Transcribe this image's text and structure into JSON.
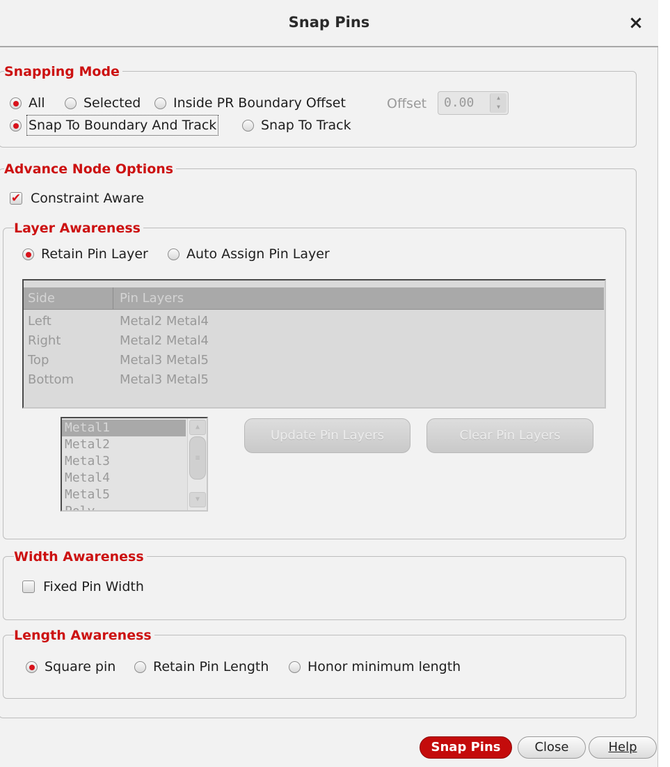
{
  "dialog": {
    "title": "Snap Pins",
    "close_glyph": "×"
  },
  "snapping_mode": {
    "legend": "Snapping Mode",
    "scope": [
      {
        "label": "All",
        "selected": true
      },
      {
        "label": "Selected",
        "selected": false
      },
      {
        "label": "Inside PR Boundary Offset",
        "selected": false
      }
    ],
    "offset_label": "Offset",
    "offset_value": "0.00",
    "target": [
      {
        "label": "Snap To Boundary And Track",
        "selected": true
      },
      {
        "label": "Snap To Track",
        "selected": false
      }
    ]
  },
  "advance_node": {
    "legend": "Advance Node Options",
    "constraint_aware": {
      "label": "Constraint Aware",
      "checked": true
    },
    "layer_awareness": {
      "legend": "Layer Awareness",
      "options": [
        {
          "label": "Retain Pin Layer",
          "selected": true
        },
        {
          "label": "Auto Assign Pin Layer",
          "selected": false
        }
      ],
      "table": {
        "headers": [
          "Side",
          "Pin Layers"
        ],
        "rows": [
          [
            "Left",
            "Metal2 Metal4"
          ],
          [
            "Right",
            "Metal2 Metal4"
          ],
          [
            "Top",
            "Metal3 Metal5"
          ],
          [
            "Bottom",
            "Metal3 Metal5"
          ]
        ]
      },
      "layer_list": [
        "Metal1",
        "Metal2",
        "Metal3",
        "Metal4",
        "Metal5",
        "Poly"
      ],
      "selected_layer": "Metal1",
      "update_button": "Update Pin Layers",
      "clear_button": "Clear Pin Layers"
    },
    "width_awareness": {
      "legend": "Width Awareness",
      "fixed_pin_width": {
        "label": "Fixed Pin Width",
        "checked": false
      }
    },
    "length_awareness": {
      "legend": "Length Awareness",
      "options": [
        {
          "label": "Square pin",
          "selected": true
        },
        {
          "label": "Retain Pin Length",
          "selected": false
        },
        {
          "label": "Honor minimum length",
          "selected": false
        }
      ]
    }
  },
  "footer": {
    "snap_pins": "Snap Pins",
    "close": "Close",
    "help": "Help"
  },
  "colors": {
    "accent": "#cc1111",
    "primary_button": "#c40b0b",
    "dialog_bg": "#f2f2f2"
  },
  "icons": {
    "close": "close-icon",
    "checkmark": "checkmark-icon",
    "spin_arrows": "spin-arrows-icon",
    "scroll_up": "scroll-up-icon",
    "scroll_down": "scroll-down-icon"
  }
}
